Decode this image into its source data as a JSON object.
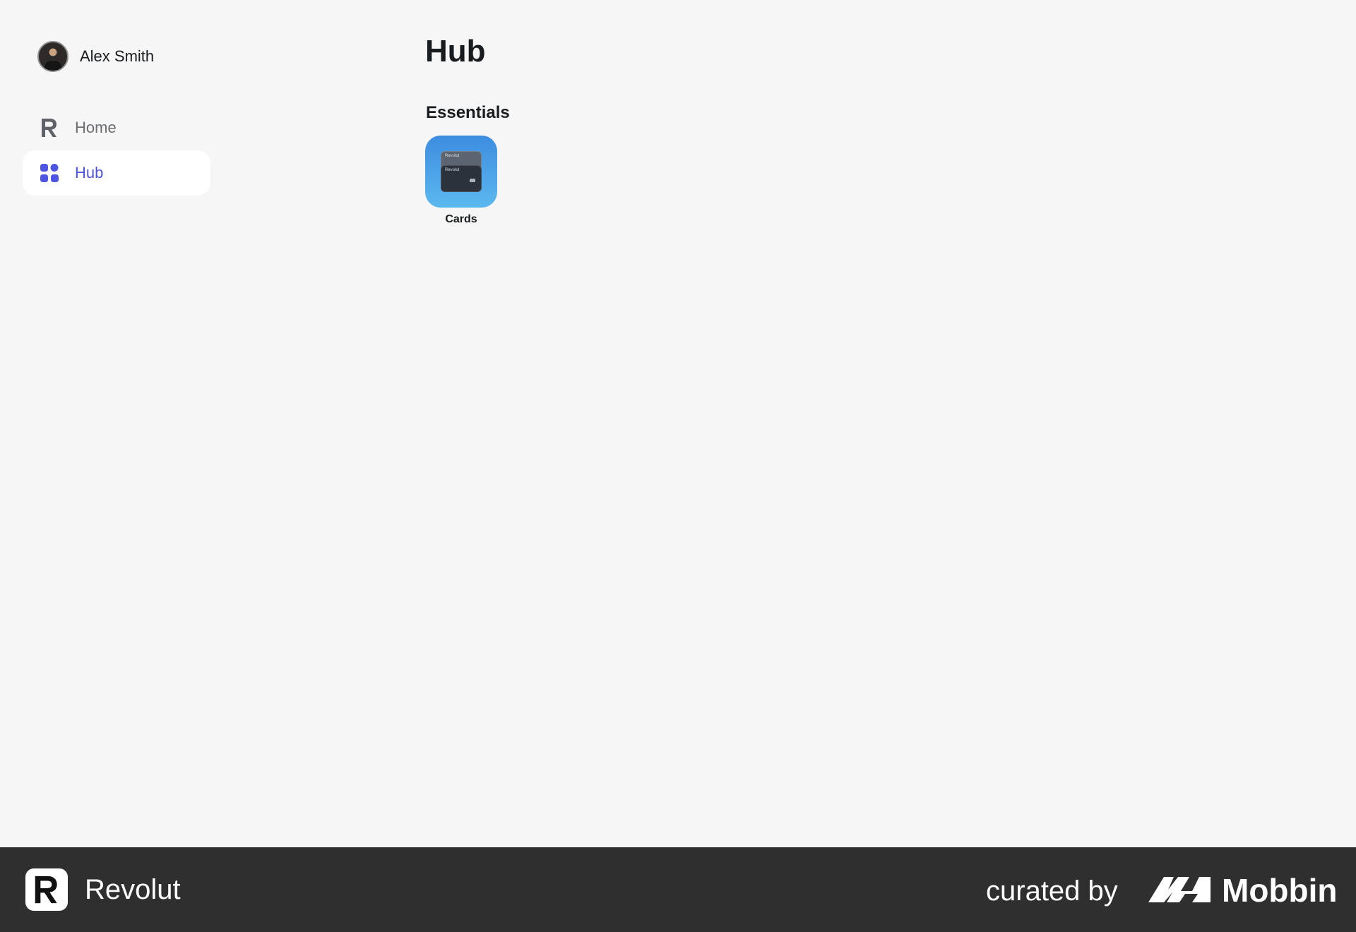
{
  "user": {
    "name": "Alex Smith"
  },
  "sidebar": {
    "items": [
      {
        "label": "Home",
        "icon": "revolut-r-icon"
      },
      {
        "label": "Hub",
        "icon": "grid-icon",
        "active": true
      }
    ]
  },
  "main": {
    "title": "Hub",
    "sections": [
      {
        "title": "Essentials",
        "tiles": [
          {
            "label": "Cards",
            "icon": "cards-icon",
            "card_brand": "Revolut"
          }
        ]
      }
    ]
  },
  "footer": {
    "brand_name": "Revolut",
    "curated_text": "curated by",
    "curator_name": "Mobbin"
  },
  "colors": {
    "background": "#f6f6f6",
    "accent": "#4f55e3",
    "footer_bg": "#2f2f2f"
  }
}
